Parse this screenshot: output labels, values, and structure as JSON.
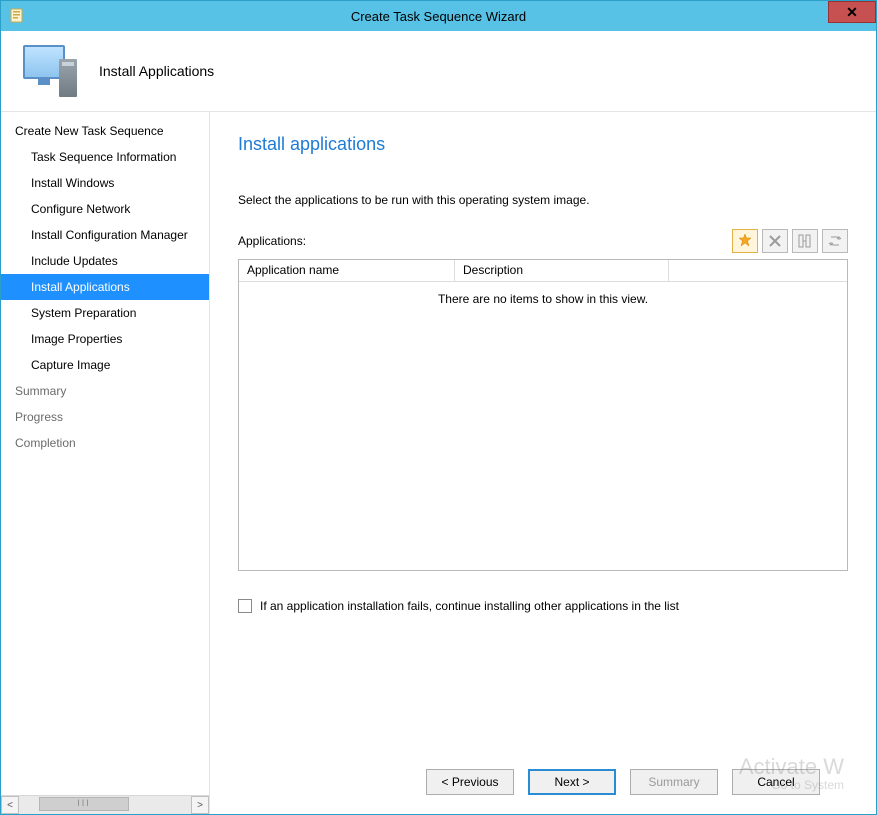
{
  "window": {
    "title": "Create Task Sequence Wizard"
  },
  "header": {
    "step_title": "Install Applications"
  },
  "nav": {
    "items": [
      {
        "label": "Create New Task Sequence",
        "level": "top",
        "state": "normal"
      },
      {
        "label": "Task Sequence Information",
        "level": "sub",
        "state": "normal"
      },
      {
        "label": "Install Windows",
        "level": "sub",
        "state": "normal"
      },
      {
        "label": "Configure Network",
        "level": "sub",
        "state": "normal"
      },
      {
        "label": "Install Configuration Manager",
        "level": "sub",
        "state": "normal"
      },
      {
        "label": "Include Updates",
        "level": "sub",
        "state": "normal"
      },
      {
        "label": "Install Applications",
        "level": "sub",
        "state": "selected"
      },
      {
        "label": "System Preparation",
        "level": "sub",
        "state": "normal"
      },
      {
        "label": "Image Properties",
        "level": "sub",
        "state": "normal"
      },
      {
        "label": "Capture Image",
        "level": "sub",
        "state": "normal"
      },
      {
        "label": "Summary",
        "level": "top",
        "state": "dim"
      },
      {
        "label": "Progress",
        "level": "top",
        "state": "dim"
      },
      {
        "label": "Completion",
        "level": "top",
        "state": "dim"
      }
    ]
  },
  "page": {
    "heading": "Install applications",
    "instruction": "Select the applications to be run with this operating system image.",
    "list_label": "Applications:",
    "columns": {
      "name": "Application name",
      "description": "Description"
    },
    "empty_text": "There are no items to show in this view.",
    "checkbox_label": "If an application installation fails, continue installing other applications in the list",
    "checkbox_checked": false
  },
  "toolbar": {
    "add": "add",
    "delete": "delete",
    "properties": "properties",
    "reorder": "reorder"
  },
  "footer": {
    "previous": "< Previous",
    "next": "Next >",
    "summary": "Summary",
    "cancel": "Cancel"
  },
  "watermark": {
    "line1": "Activate W",
    "line2": "Go to System"
  },
  "glyphs": {
    "scroll_left": "<",
    "scroll_right": ">",
    "scroll_grip": "III",
    "close": "✕"
  }
}
